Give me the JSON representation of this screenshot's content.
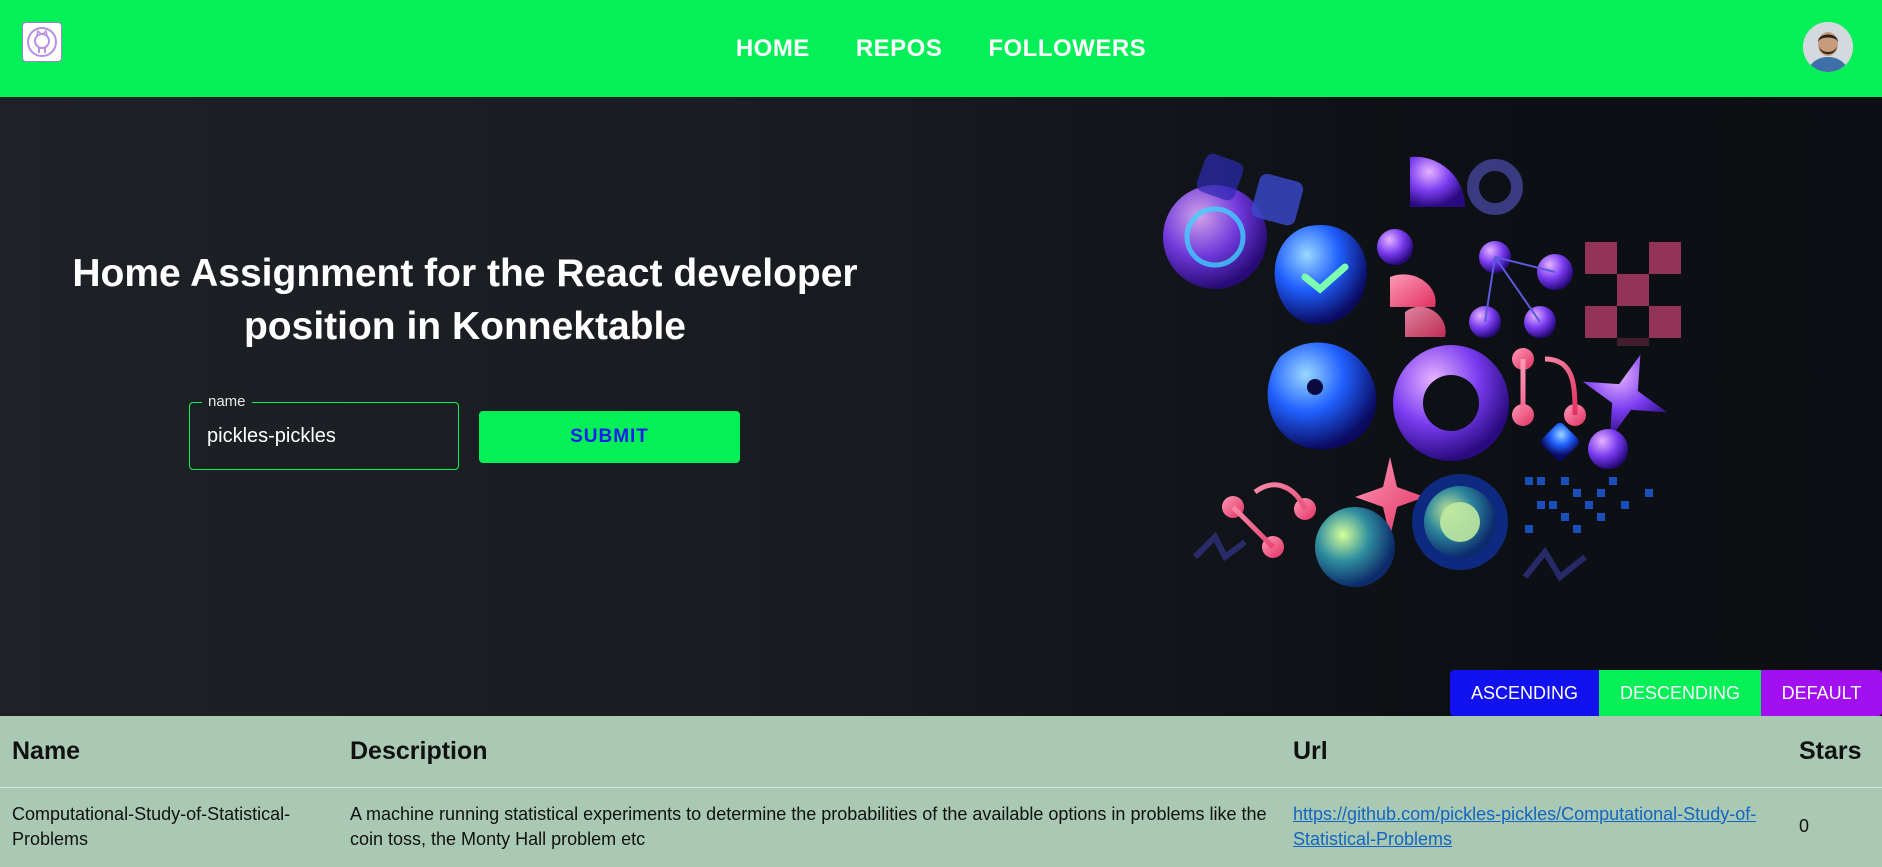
{
  "navbar": {
    "logo_icon": "github-octocat-icon",
    "links": [
      {
        "label": "HOME"
      },
      {
        "label": "REPOS"
      },
      {
        "label": "FOLLOWERS"
      }
    ],
    "avatar_icon": "user-avatar",
    "background": "#05ef57"
  },
  "hero": {
    "title": "Home Assignment for the React developer position in Konnektable",
    "form": {
      "field_label": "name",
      "field_value": "pickles-pickles",
      "submit_label": "SUBMIT"
    },
    "art_icon": "github-illustration"
  },
  "sort": {
    "ascending": "ASCENDING",
    "descending": "DESCENDING",
    "default": "DEFAULT",
    "colors": {
      "ascending": "#1212f0",
      "descending": "#05ef57",
      "default": "#a20ff0"
    }
  },
  "table": {
    "headers": [
      "Name",
      "Description",
      "Url",
      "Stars"
    ],
    "rows": [
      {
        "name": "Computational-Study-of-Statistical-Problems",
        "description": "A machine running statistical experiments to determine the probabilities of the available options in problems like the coin toss, the Monty Hall problem etc",
        "url": "https://github.com/pickles-pickles/Computational-Study-of-Statistical-Problems",
        "stars": "0"
      }
    ]
  }
}
